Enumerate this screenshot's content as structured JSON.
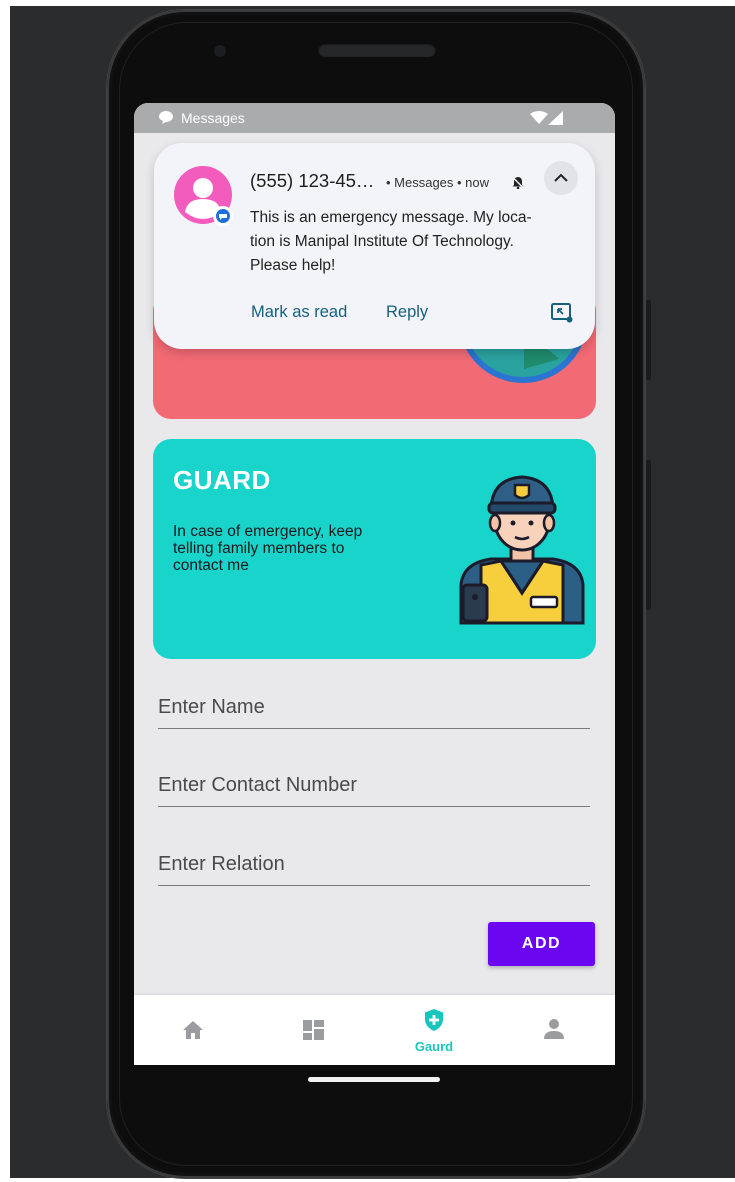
{
  "status_bar": {
    "app_label": "Messages",
    "icons": [
      "messages-icon",
      "wifi-icon",
      "signal-icon"
    ]
  },
  "notification": {
    "sender": "(555) 123-45…",
    "meta": "• Messages • now",
    "body": "This is an emergency message. My loca-tion is Manipal Institute Of Technology. Please help!",
    "body_lines": [
      "This is an emergency message. My loca-",
      "tion is Manipal Institute Of Technology.",
      "Please help!"
    ],
    "actions": {
      "mark_read": "Mark as read",
      "reply": "Reply"
    },
    "icons": [
      "contact-avatar-icon",
      "bell-off-icon",
      "chevron-up-icon",
      "picture-in-picture-icon"
    ]
  },
  "guard_card": {
    "title": "GUARD",
    "description": "In case of emergency, keep telling family members to contact me",
    "illustration": "security-guard-illustration"
  },
  "form": {
    "name_placeholder": "Enter Name",
    "contact_placeholder": "Enter Contact Number",
    "relation_placeholder": "Enter Relation",
    "add_label": "ADD"
  },
  "bottom_nav": {
    "items": [
      {
        "icon": "home-icon",
        "label": "",
        "active": false
      },
      {
        "icon": "dashboard-icon",
        "label": "",
        "active": false
      },
      {
        "icon": "shield-plus-icon",
        "label": "Gaurd",
        "active": true
      },
      {
        "icon": "person-icon",
        "label": "",
        "active": false
      }
    ]
  },
  "colors": {
    "accent_purple": "#6a06f1",
    "guard_teal": "#18d4cb",
    "alert_red": "#f26a74",
    "nav_active": "#19c6be",
    "avatar_pink": "#f35cbd"
  }
}
